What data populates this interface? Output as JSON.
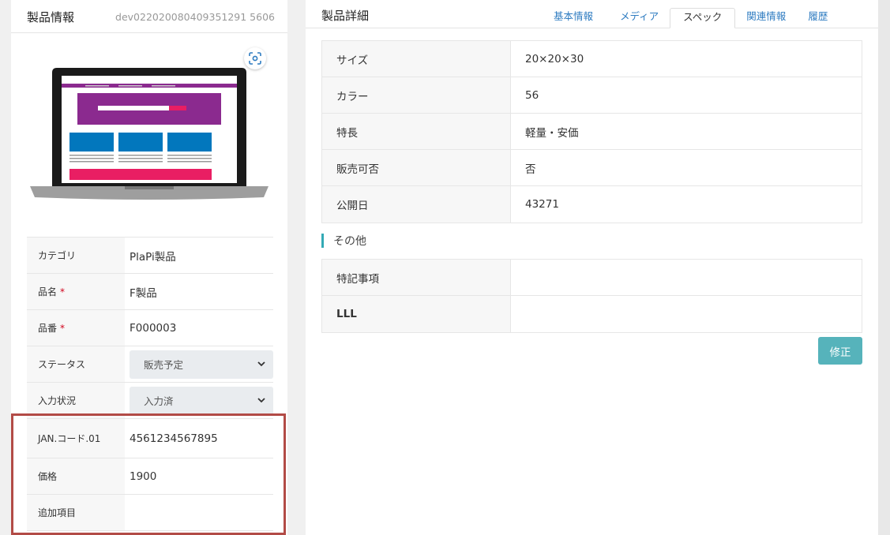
{
  "left": {
    "title": "製品情報",
    "code": "dev022020080409351291 5606",
    "rows": [
      {
        "label": "カテゴリ",
        "value": "PlaPi製品",
        "required": false
      },
      {
        "label": "品名",
        "value": "F製品",
        "required": true
      },
      {
        "label": "品番",
        "value": "F000003",
        "required": true
      }
    ],
    "status": {
      "label": "ステータス",
      "value": "販売予定"
    },
    "input_state": {
      "label": "入力状況",
      "value": "入力済"
    },
    "extra_rows": [
      {
        "label": "JAN.コード.01",
        "value": "4561234567895"
      },
      {
        "label": "価格",
        "value": "1900"
      },
      {
        "label": "追加項目",
        "value": ""
      }
    ],
    "required_mark": "*"
  },
  "right": {
    "title": "製品詳細",
    "tabs": [
      "基本情報",
      "メディア",
      "スペック",
      "関連情報",
      "履歴"
    ],
    "active_tab": "スペック",
    "spec_rows": [
      {
        "label": "サイズ",
        "value": "20×20×30"
      },
      {
        "label": "カラー",
        "value": "56"
      },
      {
        "label": "特長",
        "value": "軽量・安価"
      },
      {
        "label": "販売可否",
        "value": "否"
      },
      {
        "label": "公開日",
        "value": "43271"
      }
    ],
    "section_title": "その他",
    "other_rows": [
      {
        "label": "特記事項",
        "value": ""
      },
      {
        "label": "LLL",
        "value": ""
      }
    ],
    "edit_label": "修正"
  },
  "icons": {
    "focus": "focus-camera-icon",
    "chevron": "chevron-down-icon"
  },
  "colors": {
    "accent": "#56b3bb",
    "link": "#2f7cc1",
    "highlight_box": "#b24b46",
    "required": "#d0021b"
  }
}
